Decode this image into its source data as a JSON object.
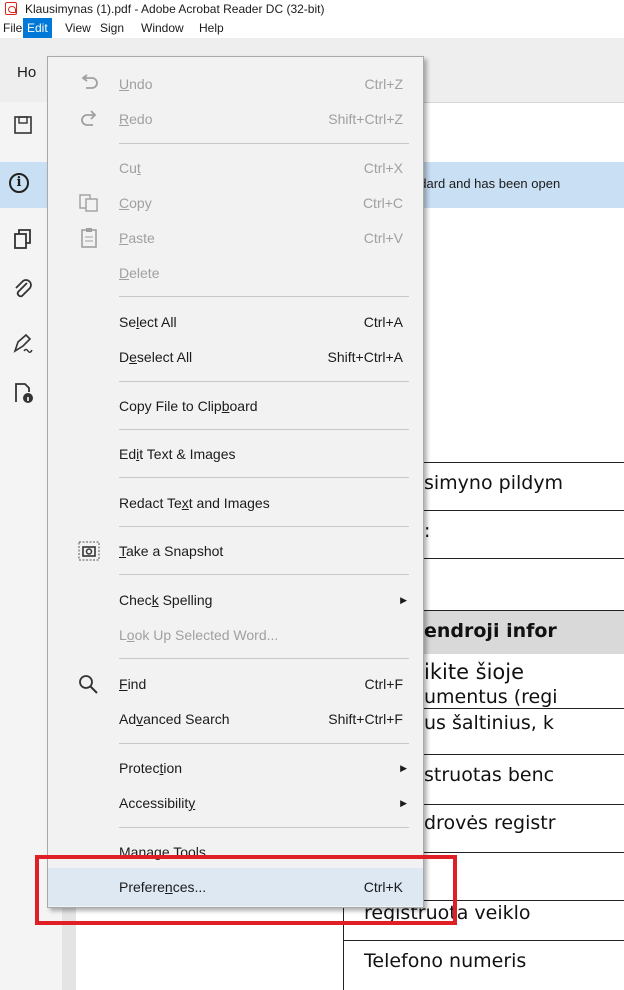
{
  "window": {
    "title": "Klausimynas (1).pdf - Adobe Acrobat Reader DC (32-bit)"
  },
  "menubar": {
    "items": [
      "File",
      "Edit",
      "View",
      "Sign",
      "Window",
      "Help"
    ],
    "active": "Edit"
  },
  "toolbar": {
    "home_tab": "Ho"
  },
  "infobar": {
    "message": "ndard and has been open"
  },
  "document": {
    "lines": [
      "simyno pildym",
      ":",
      "endroji infor",
      "ikite   šioje",
      "umentus (regi",
      "us šaltinius, k",
      "struotas benc",
      "drovės registr",
      "registruota veiklo",
      "Telefono numeris"
    ]
  },
  "edit_menu": {
    "undo": {
      "pre": "",
      "key": "U",
      "post": "ndo",
      "shortcut": "Ctrl+Z"
    },
    "redo": {
      "pre": "",
      "key": "R",
      "post": "edo",
      "shortcut": "Shift+Ctrl+Z"
    },
    "cut": {
      "pre": "Cu",
      "key": "t",
      "post": "",
      "shortcut": "Ctrl+X"
    },
    "copy": {
      "pre": "",
      "key": "C",
      "post": "opy",
      "shortcut": "Ctrl+C"
    },
    "paste": {
      "pre": "",
      "key": "P",
      "post": "aste",
      "shortcut": "Ctrl+V"
    },
    "delete": {
      "pre": "",
      "key": "D",
      "post": "elete"
    },
    "select_all": {
      "pre": "Se",
      "key": "l",
      "post": "ect All",
      "shortcut": "Ctrl+A"
    },
    "deselect_all": {
      "pre": "D",
      "key": "e",
      "post": "select All",
      "shortcut": "Shift+Ctrl+A"
    },
    "copy_file": {
      "pre": "Copy File to Clip",
      "key": "b",
      "post": "oard"
    },
    "edit_text": {
      "pre": "Ed",
      "key": "i",
      "post": "t Text & Images"
    },
    "redact": {
      "pre": "Redact Te",
      "key": "x",
      "post": "t and Images"
    },
    "snapshot": {
      "pre": "",
      "key": "T",
      "post": "ake a Snapshot"
    },
    "spelling": {
      "pre": "Chec",
      "key": "k",
      "post": " Spelling"
    },
    "lookup": {
      "pre": "L",
      "key": "o",
      "post": "ok Up Selected Word..."
    },
    "find": {
      "pre": "",
      "key": "F",
      "post": "ind",
      "shortcut": "Ctrl+F"
    },
    "advanced_search": {
      "pre": "Ad",
      "key": "v",
      "post": "anced Search",
      "shortcut": "Shift+Ctrl+F"
    },
    "protection": {
      "pre": "Protec",
      "key": "t",
      "post": "ion"
    },
    "accessibility": {
      "pre": "Accessibilit",
      "key": "y",
      "post": ""
    },
    "manage_tools": {
      "pre": "",
      "key": "M",
      "post": "anage Tools"
    },
    "preferences": {
      "pre": "Prefere",
      "key": "n",
      "post": "ces...",
      "shortcut": "Ctrl+K"
    }
  },
  "colors": {
    "accent": "#0078d7",
    "highlight_box": "#e01e26",
    "infobar": "#c9dff3"
  }
}
